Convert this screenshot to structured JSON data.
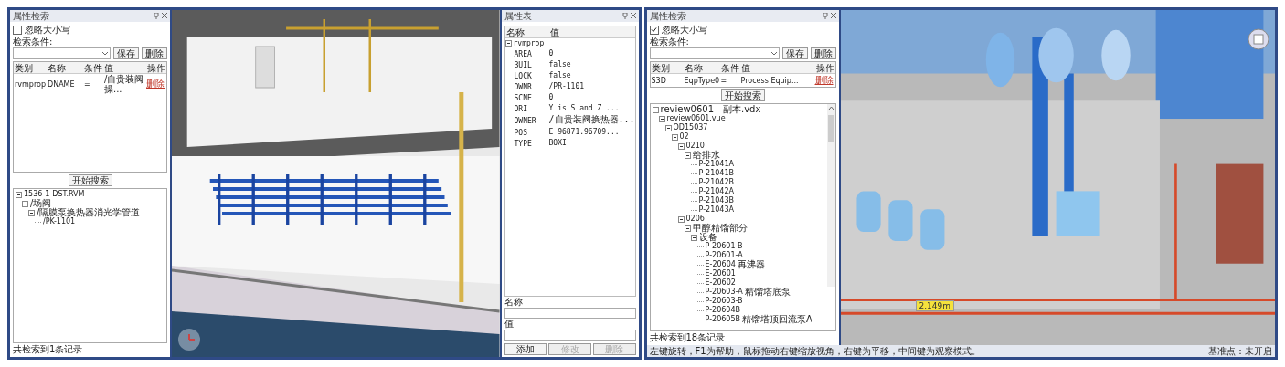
{
  "left_window": {
    "search_panel": {
      "title": "属性检索",
      "ignore_case": {
        "label": "忽略大小写",
        "checked": false
      },
      "condition_label": "检索条件:",
      "buttons": [
        "保存",
        "删除"
      ],
      "columns": [
        "类别",
        "名称",
        "条件",
        "值",
        "操作"
      ],
      "rows": [
        {
          "cells": [
            "rvmprop",
            "DNAME",
            "=",
            "/自贵装阀操..."
          ],
          "action": "删除"
        }
      ],
      "start_button": "开始搜索",
      "tree": [
        {
          "label": "1536-1-DST.RVM",
          "expanded": true,
          "children": [
            {
              "label": "/场阀",
              "expanded": true,
              "children": [
                {
                  "label": "/隔膜泵换热器消光学管道",
                  "expanded": true,
                  "children": [
                    {
                      "label": "/PK-1101"
                    }
                  ]
                }
              ]
            }
          ]
        }
      ],
      "result_count": "共检索到1条记录"
    },
    "property_panel": {
      "title": "属性表",
      "columns": [
        "名称",
        "值"
      ],
      "group": "rvmprop",
      "rows": [
        [
          "AREA",
          "0"
        ],
        [
          "BUIL",
          "false"
        ],
        [
          "LOCK",
          "false"
        ],
        [
          "OWNR",
          "/PR-1101"
        ],
        [
          "SCNE",
          "0"
        ],
        [
          "ORI",
          "Y is S and Z ..."
        ],
        [
          "OWNER",
          "/自贵装阀换热器..."
        ],
        [
          "POS",
          "E 96871.96709..."
        ],
        [
          "TYPE",
          "BOXI"
        ]
      ],
      "name_label": "名称",
      "value_label": "值",
      "buttons": [
        {
          "label": "添加",
          "disabled": false
        },
        {
          "label": "修改",
          "disabled": true
        },
        {
          "label": "删除",
          "disabled": true
        }
      ]
    }
  },
  "right_window": {
    "search_panel": {
      "title": "属性检索",
      "ignore_case": {
        "label": "忽略大小写",
        "checked": true
      },
      "condition_label": "检索条件:",
      "buttons": [
        "保存",
        "删除"
      ],
      "columns": [
        "类别",
        "名称",
        "条件",
        "值",
        "操作"
      ],
      "rows": [
        {
          "cells": [
            "S3D",
            "EqpType0",
            "=",
            "Process Equip..."
          ],
          "action": "删除"
        }
      ],
      "start_button": "开始搜索",
      "tree": [
        {
          "label": "review0601 - 副本.vdx",
          "expanded": true,
          "children": [
            {
              "label": "review0601.vue",
              "expanded": true,
              "children": [
                {
                  "label": "OD15037",
                  "expanded": true,
                  "children": [
                    {
                      "label": "02",
                      "expanded": true,
                      "children": [
                        {
                          "label": "0210",
                          "expanded": true,
                          "children": [
                            {
                              "label": "给排水",
                              "expanded": true,
                              "children": [
                                {
                                  "label": "P-21041A"
                                },
                                {
                                  "label": "P-21041B"
                                },
                                {
                                  "label": "P-21042B"
                                },
                                {
                                  "label": "P-21042A"
                                },
                                {
                                  "label": "P-21043B"
                                },
                                {
                                  "label": "P-21043A"
                                }
                              ]
                            }
                          ]
                        },
                        {
                          "label": "0206",
                          "expanded": true,
                          "children": [
                            {
                              "label": "甲醇精馏部分",
                              "expanded": true,
                              "children": [
                                {
                                  "label": "设备",
                                  "expanded": true,
                                  "children": [
                                    {
                                      "label": "P-20601-B"
                                    },
                                    {
                                      "label": "P-20601-A"
                                    },
                                    {
                                      "label": "E-20604",
                                      "note": "再沸器"
                                    },
                                    {
                                      "label": "E-20601"
                                    },
                                    {
                                      "label": "E-20602"
                                    },
                                    {
                                      "label": "P-20603-A",
                                      "note": "精馏塔底泵"
                                    },
                                    {
                                      "label": "P-20603-B"
                                    },
                                    {
                                      "label": "P-20604B"
                                    },
                                    {
                                      "label": "P-20605B",
                                      "note": "精馏塔顶回流泵A"
                                    }
                                  ]
                                }
                              ]
                            }
                          ]
                        }
                      ]
                    }
                  ]
                }
              ]
            }
          ]
        }
      ],
      "result_count": "共检索到18条记录"
    },
    "measure_label": "2.149m",
    "status_bar": {
      "hint": "左键旋转，F1为帮助，鼠标拖动右键缩放视角，右键为平移，中间键为观察模式。",
      "reference": "基准点：未开启"
    }
  }
}
